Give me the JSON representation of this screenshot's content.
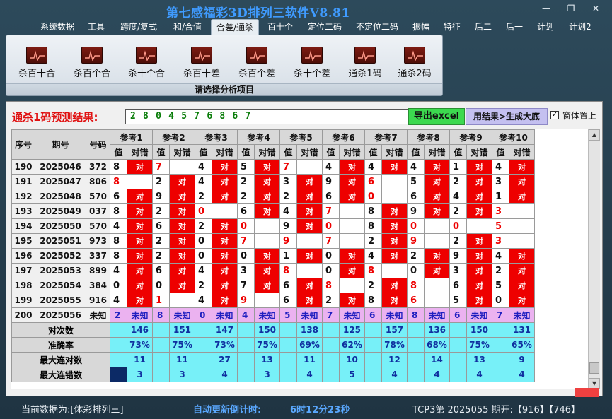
{
  "title": "第七感福彩3D排列三软件V8.81",
  "window_controls": [
    "—",
    "❐",
    "✕"
  ],
  "menu": [
    "系统数据",
    "工具",
    "跨度/复式",
    "和/合值",
    "合差/通杀",
    "百十个",
    "定位二码",
    "不定位二码",
    "振幅",
    "特征",
    "后二",
    "后一",
    "计划",
    "计划2"
  ],
  "active_menu": "合差/通杀",
  "ribbon": {
    "buttons": [
      "杀百十合",
      "杀百个合",
      "杀十个合",
      "杀百十差",
      "杀百个差",
      "杀十个差",
      "通杀1码",
      "通杀2码"
    ],
    "group_label": "请选择分析项目"
  },
  "result": {
    "label": "通杀1码预测结果:",
    "value": "2 8 0 4 5 7 6 8 6 7",
    "excel_button": "导出excel",
    "gen_button": "用结果>生成大底",
    "topmost_label": "窗体置上",
    "topmost_checked": true
  },
  "grid": {
    "col_headers": [
      "序号",
      "期号",
      "号码"
    ],
    "ref_headers": [
      "参考1",
      "参考2",
      "参考3",
      "参考4",
      "参考5",
      "参考6",
      "参考7",
      "参考8",
      "参考9",
      "参考10"
    ],
    "sub_headers": [
      "值",
      "对错"
    ],
    "hit_text": "对",
    "unknown_text": "未知",
    "rows": [
      {
        "seq": "190",
        "issue": "2025046",
        "num": "372",
        "refs": [
          [
            "8",
            1
          ],
          [
            "7",
            0
          ],
          [
            "4",
            1
          ],
          [
            "5",
            1
          ],
          [
            "7",
            0
          ],
          [
            "4",
            1
          ],
          [
            "4",
            1
          ],
          [
            "4",
            1
          ],
          [
            "1",
            1
          ],
          [
            "4",
            1
          ]
        ],
        "red": [
          2,
          5
        ]
      },
      {
        "seq": "191",
        "issue": "2025047",
        "num": "806",
        "refs": [
          [
            "8",
            0
          ],
          [
            "2",
            1
          ],
          [
            "4",
            1
          ],
          [
            "2",
            1
          ],
          [
            "3",
            1
          ],
          [
            "9",
            1
          ],
          [
            "6",
            0
          ],
          [
            "5",
            1
          ],
          [
            "2",
            1
          ],
          [
            "3",
            1
          ]
        ],
        "red": [
          1,
          7
        ]
      },
      {
        "seq": "192",
        "issue": "2025048",
        "num": "570",
        "refs": [
          [
            "6",
            1
          ],
          [
            "9",
            1
          ],
          [
            "2",
            1
          ],
          [
            "2",
            1
          ],
          [
            "2",
            1
          ],
          [
            "6",
            1
          ],
          [
            "0",
            0
          ],
          [
            "6",
            1
          ],
          [
            "4",
            1
          ],
          [
            "1",
            1
          ]
        ],
        "red": [
          7
        ]
      },
      {
        "seq": "193",
        "issue": "2025049",
        "num": "037",
        "refs": [
          [
            "8",
            1
          ],
          [
            "2",
            1
          ],
          [
            "0",
            0
          ],
          [
            "6",
            1
          ],
          [
            "4",
            1
          ],
          [
            "7",
            0
          ],
          [
            "8",
            1
          ],
          [
            "9",
            1
          ],
          [
            "2",
            1
          ],
          [
            "3",
            0
          ]
        ],
        "red": [
          3,
          6,
          10
        ]
      },
      {
        "seq": "194",
        "issue": "2025050",
        "num": "570",
        "refs": [
          [
            "4",
            1
          ],
          [
            "6",
            1
          ],
          [
            "2",
            1
          ],
          [
            "0",
            0
          ],
          [
            "9",
            1
          ],
          [
            "0",
            0
          ],
          [
            "8",
            1
          ],
          [
            "0",
            0
          ],
          [
            "0",
            0
          ],
          [
            "5",
            0
          ]
        ],
        "red": [
          4,
          6,
          8,
          9,
          10
        ]
      },
      {
        "seq": "195",
        "issue": "2025051",
        "num": "973",
        "refs": [
          [
            "8",
            1
          ],
          [
            "2",
            1
          ],
          [
            "0",
            1
          ],
          [
            "7",
            0
          ],
          [
            "9",
            0
          ],
          [
            "7",
            0
          ],
          [
            "2",
            1
          ],
          [
            "9",
            0
          ],
          [
            "2",
            1
          ],
          [
            "3",
            0
          ]
        ],
        "red": [
          4,
          5,
          6,
          8,
          10
        ]
      },
      {
        "seq": "196",
        "issue": "2025052",
        "num": "337",
        "refs": [
          [
            "8",
            1
          ],
          [
            "2",
            1
          ],
          [
            "0",
            1
          ],
          [
            "0",
            1
          ],
          [
            "1",
            1
          ],
          [
            "0",
            1
          ],
          [
            "4",
            1
          ],
          [
            "2",
            1
          ],
          [
            "9",
            1
          ],
          [
            "4",
            1
          ]
        ],
        "red": []
      },
      {
        "seq": "197",
        "issue": "2025053",
        "num": "899",
        "refs": [
          [
            "4",
            1
          ],
          [
            "6",
            1
          ],
          [
            "4",
            1
          ],
          [
            "3",
            1
          ],
          [
            "8",
            0
          ],
          [
            "0",
            1
          ],
          [
            "8",
            0
          ],
          [
            "0",
            1
          ],
          [
            "3",
            1
          ],
          [
            "2",
            1
          ]
        ],
        "red": [
          5,
          7
        ]
      },
      {
        "seq": "198",
        "issue": "2025054",
        "num": "384",
        "refs": [
          [
            "0",
            1
          ],
          [
            "0",
            1
          ],
          [
            "2",
            1
          ],
          [
            "7",
            1
          ],
          [
            "6",
            1
          ],
          [
            "8",
            0
          ],
          [
            "2",
            1
          ],
          [
            "8",
            0
          ],
          [
            "6",
            1
          ],
          [
            "5",
            1
          ]
        ],
        "red": [
          6,
          8
        ]
      },
      {
        "seq": "199",
        "issue": "2025055",
        "num": "916",
        "refs": [
          [
            "4",
            1
          ],
          [
            "1",
            0
          ],
          [
            "4",
            1
          ],
          [
            "9",
            0
          ],
          [
            "6",
            1
          ],
          [
            "2",
            1
          ],
          [
            "8",
            1
          ],
          [
            "6",
            0
          ],
          [
            "5",
            1
          ],
          [
            "0",
            1
          ]
        ],
        "red": [
          2,
          4,
          8
        ]
      }
    ],
    "predict_row": {
      "seq": "200",
      "issue": "2025056",
      "num": "未知",
      "values": [
        "2",
        "8",
        "0",
        "4",
        "5",
        "7",
        "6",
        "8",
        "6",
        "7"
      ]
    },
    "stats": [
      {
        "label": "对次数",
        "values": [
          "146",
          "151",
          "147",
          "150",
          "138",
          "125",
          "157",
          "136",
          "150",
          "131"
        ]
      },
      {
        "label": "准确率",
        "values": [
          "73%",
          "75%",
          "73%",
          "75%",
          "69%",
          "62%",
          "78%",
          "68%",
          "75%",
          "65%"
        ]
      },
      {
        "label": "最大连对数",
        "values": [
          "11",
          "11",
          "27",
          "13",
          "11",
          "10",
          "12",
          "14",
          "13",
          "9"
        ]
      },
      {
        "label": "最大连错数",
        "values": [
          "3",
          "3",
          "4",
          "3",
          "4",
          "5",
          "4",
          "4",
          "4",
          "4"
        ]
      }
    ]
  },
  "status": {
    "current_data": "当前数据为:[体彩排列三]",
    "countdown_label": "自动更新倒计时:",
    "countdown_value": "6时12分23秒",
    "draw_info": "TCP3第 2025055 期开:【916】【746】"
  },
  "colors": {
    "hit": "#ee0000",
    "stat_bg": "#77f0f8",
    "unknown_bg": "#ebb2f0",
    "title": "#3f9bff"
  }
}
